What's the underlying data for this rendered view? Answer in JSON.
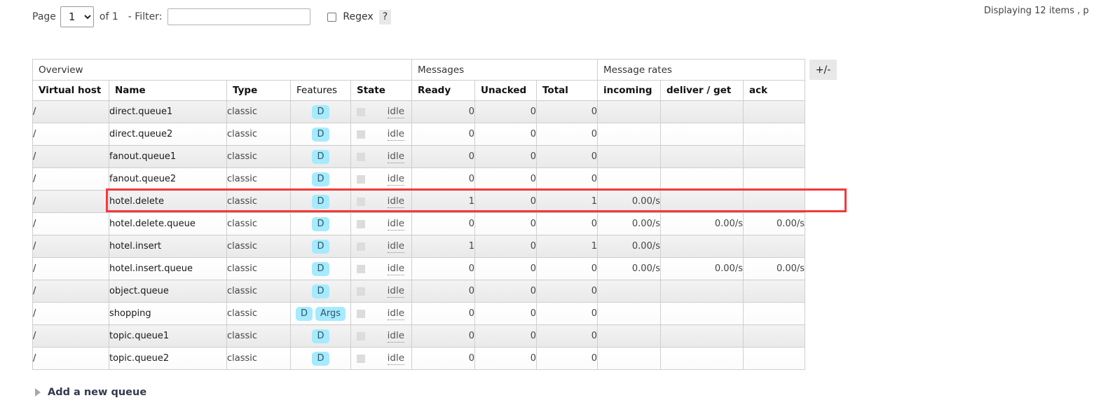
{
  "toolbar": {
    "page_label": "Page",
    "page_value": "1",
    "page_options": [
      "1"
    ],
    "of_label": "of 1",
    "filter_label": "- Filter:",
    "filter_value": "",
    "filter_placeholder": "",
    "regex_label": "Regex",
    "regex_checked": false,
    "help_label": "?",
    "chevron_icon": "chevron-down-icon"
  },
  "status": {
    "displaying": "Displaying 12 items , p"
  },
  "table": {
    "group_headers": [
      {
        "label": "Overview",
        "span": 5
      },
      {
        "label": "Messages",
        "span": 3
      },
      {
        "label": "Message rates",
        "span": 3
      }
    ],
    "columns": [
      {
        "label": "Virtual host",
        "bold": true
      },
      {
        "label": "Name",
        "bold": true
      },
      {
        "label": "Type",
        "bold": true
      },
      {
        "label": "Features",
        "bold": false
      },
      {
        "label": "State",
        "bold": true
      },
      {
        "label": "Ready",
        "bold": true
      },
      {
        "label": "Unacked",
        "bold": true
      },
      {
        "label": "Total",
        "bold": true
      },
      {
        "label": "incoming",
        "bold": true
      },
      {
        "label": "deliver / get",
        "bold": true
      },
      {
        "label": "ack",
        "bold": true
      }
    ],
    "toggle_label": "+/-",
    "rows": [
      {
        "vhost": "/",
        "name": "direct.queue1",
        "type": "classic",
        "features": [
          "D"
        ],
        "state": "idle",
        "ready": "0",
        "unacked": "0",
        "total": "0",
        "incoming": "",
        "deliver_get": "",
        "ack": ""
      },
      {
        "vhost": "/",
        "name": "direct.queue2",
        "type": "classic",
        "features": [
          "D"
        ],
        "state": "idle",
        "ready": "0",
        "unacked": "0",
        "total": "0",
        "incoming": "",
        "deliver_get": "",
        "ack": ""
      },
      {
        "vhost": "/",
        "name": "fanout.queue1",
        "type": "classic",
        "features": [
          "D"
        ],
        "state": "idle",
        "ready": "0",
        "unacked": "0",
        "total": "0",
        "incoming": "",
        "deliver_get": "",
        "ack": ""
      },
      {
        "vhost": "/",
        "name": "fanout.queue2",
        "type": "classic",
        "features": [
          "D"
        ],
        "state": "idle",
        "ready": "0",
        "unacked": "0",
        "total": "0",
        "incoming": "",
        "deliver_get": "",
        "ack": ""
      },
      {
        "vhost": "/",
        "name": "hotel.delete",
        "type": "classic",
        "features": [
          "D"
        ],
        "state": "idle",
        "ready": "1",
        "unacked": "0",
        "total": "1",
        "incoming": "0.00/s",
        "deliver_get": "",
        "ack": ""
      },
      {
        "vhost": "/",
        "name": "hotel.delete.queue",
        "type": "classic",
        "features": [
          "D"
        ],
        "state": "idle",
        "ready": "0",
        "unacked": "0",
        "total": "0",
        "incoming": "0.00/s",
        "deliver_get": "0.00/s",
        "ack": "0.00/s"
      },
      {
        "vhost": "/",
        "name": "hotel.insert",
        "type": "classic",
        "features": [
          "D"
        ],
        "state": "idle",
        "ready": "1",
        "unacked": "0",
        "total": "1",
        "incoming": "0.00/s",
        "deliver_get": "",
        "ack": ""
      },
      {
        "vhost": "/",
        "name": "hotel.insert.queue",
        "type": "classic",
        "features": [
          "D"
        ],
        "state": "idle",
        "ready": "0",
        "unacked": "0",
        "total": "0",
        "incoming": "0.00/s",
        "deliver_get": "0.00/s",
        "ack": "0.00/s"
      },
      {
        "vhost": "/",
        "name": "object.queue",
        "type": "classic",
        "features": [
          "D"
        ],
        "state": "idle",
        "ready": "0",
        "unacked": "0",
        "total": "0",
        "incoming": "",
        "deliver_get": "",
        "ack": ""
      },
      {
        "vhost": "/",
        "name": "shopping",
        "type": "classic",
        "features": [
          "D",
          "Args"
        ],
        "state": "idle",
        "ready": "0",
        "unacked": "0",
        "total": "0",
        "incoming": "",
        "deliver_get": "",
        "ack": ""
      },
      {
        "vhost": "/",
        "name": "topic.queue1",
        "type": "classic",
        "features": [
          "D"
        ],
        "state": "idle",
        "ready": "0",
        "unacked": "0",
        "total": "0",
        "incoming": "",
        "deliver_get": "",
        "ack": ""
      },
      {
        "vhost": "/",
        "name": "topic.queue2",
        "type": "classic",
        "features": [
          "D"
        ],
        "state": "idle",
        "ready": "0",
        "unacked": "0",
        "total": "0",
        "incoming": "",
        "deliver_get": "",
        "ack": ""
      }
    ],
    "highlighted_row_index": 4
  },
  "footer": {
    "add_queue_label": "Add a new queue",
    "expander_icon": "triangle-right-icon"
  },
  "colors": {
    "badge_bg": "#a6eaff",
    "highlight": "#f5383a",
    "row_stripe": "#ededed",
    "link": "#33394e"
  }
}
